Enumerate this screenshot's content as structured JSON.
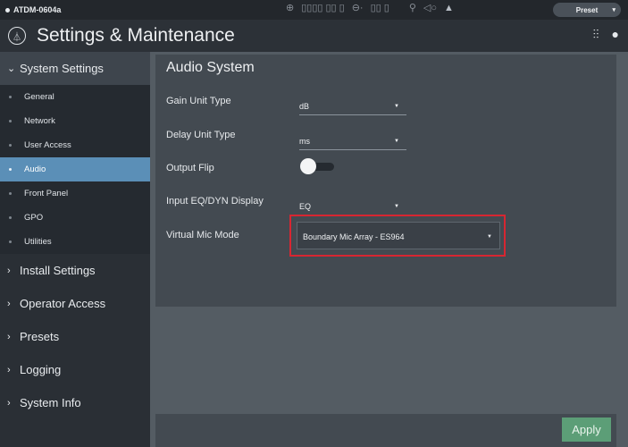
{
  "topbar": {
    "device_name": "ATDM-0604a",
    "preset_label": "Preset",
    "icons": [
      "network-icon",
      "meter-icon",
      "connection-icon",
      "level-icon",
      "link-icon",
      "mute-icon",
      "warning-icon"
    ]
  },
  "header": {
    "title": "Settings & Maintenance",
    "icons": [
      "mixer-icon",
      "user-icon"
    ]
  },
  "sidebar": {
    "sections": [
      {
        "label": "System Settings",
        "expanded": true
      },
      {
        "label": "Install Settings"
      },
      {
        "label": "Operator Access"
      },
      {
        "label": "Presets"
      },
      {
        "label": "Logging"
      },
      {
        "label": "System Info"
      }
    ],
    "system_settings_items": [
      {
        "label": "General"
      },
      {
        "label": "Network"
      },
      {
        "label": "User Access"
      },
      {
        "label": "Audio",
        "active": true
      },
      {
        "label": "Front Panel"
      },
      {
        "label": "GPO"
      },
      {
        "label": "Utilities"
      }
    ]
  },
  "main": {
    "title": "Audio System",
    "gain_unit": {
      "label": "Gain Unit Type",
      "value": "dB"
    },
    "delay_unit": {
      "label": "Delay Unit Type",
      "value": "ms"
    },
    "output_flip": {
      "label": "Output Flip",
      "state": "off"
    },
    "input_eq": {
      "label": "Input EQ/DYN Display",
      "value": "EQ"
    },
    "virtual_mic": {
      "label": "Virtual Mic Mode",
      "value": "Boundary Mic Array - ES964"
    },
    "apply_label": "Apply"
  },
  "colors": {
    "accent": "#5b8fb7",
    "apply": "#5c9e77",
    "highlight": "#d72631"
  }
}
